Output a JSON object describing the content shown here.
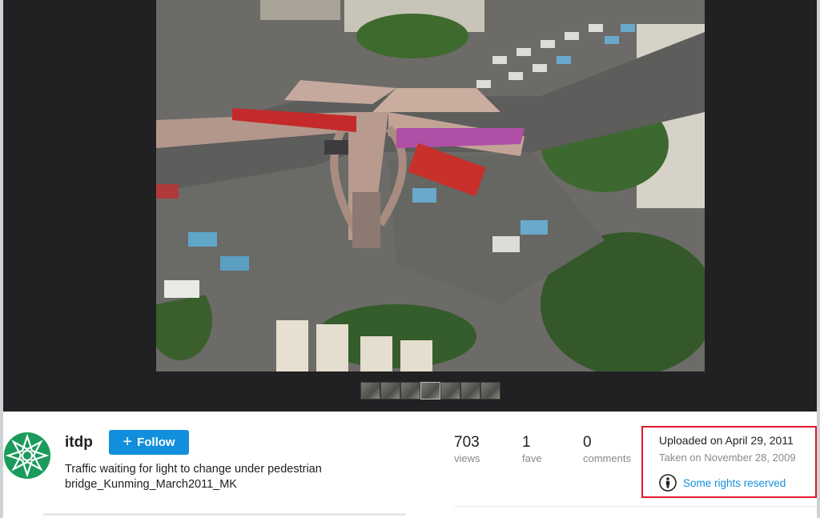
{
  "photo": {
    "alt": "Traffic waiting for light to change under pedestrian bridge_Kunming_March2011_MK",
    "filmstrip_count": 7
  },
  "owner": {
    "name": "itdp",
    "follow_label": "Follow",
    "avatar_icon": "itdp-star-logo-icon",
    "avatar_color": "#1a9a5b"
  },
  "title": "Traffic waiting for light to change under pedestrian bridge_Kunming_March2011_MK",
  "stats": [
    {
      "value": "703",
      "label": "views"
    },
    {
      "value": "1",
      "label": "fave"
    },
    {
      "value": "0",
      "label": "comments"
    }
  ],
  "meta": {
    "uploaded": "Uploaded on April 29, 2011",
    "taken": "Taken on November 28, 2009",
    "rights": "Some rights reserved",
    "rights_icon": "creative-commons-attribution-icon"
  },
  "colors": {
    "accent": "#128fdc",
    "highlight_box": "#e0192b",
    "viewer_bg": "#212124"
  }
}
